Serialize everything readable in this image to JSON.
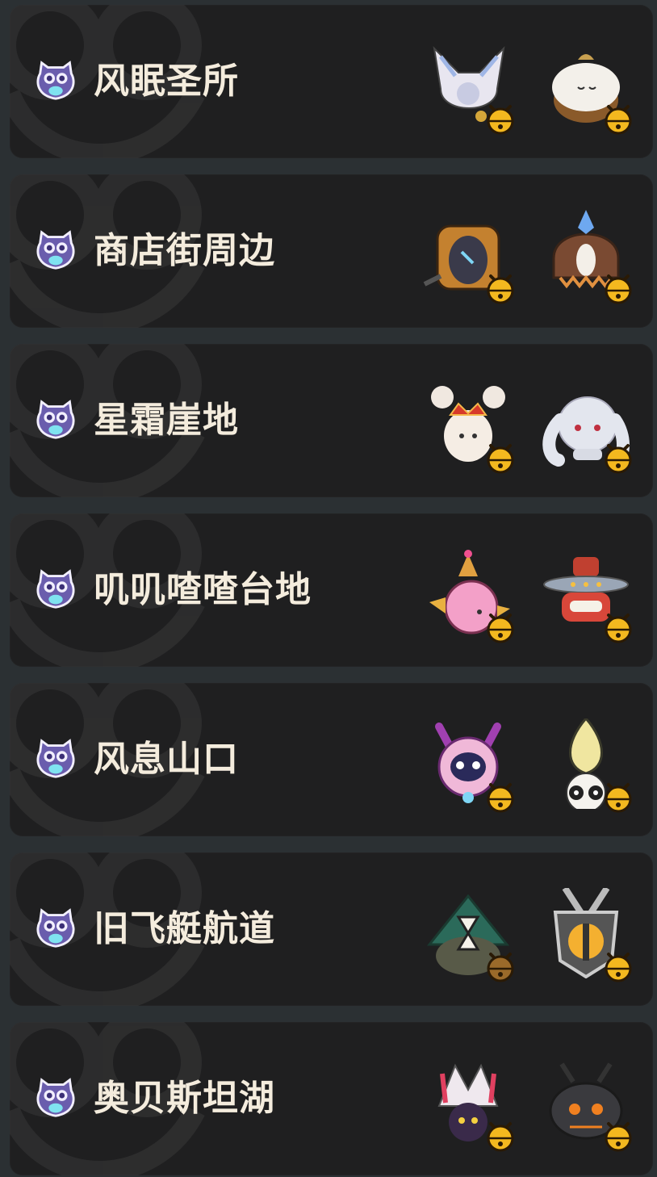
{
  "locations": [
    {
      "name": "风眠圣所",
      "spirits": [
        {
          "icon": "white-fox-spirit-icon",
          "bell": "gold"
        },
        {
          "icon": "white-acorn-spirit-icon",
          "bell": "gold"
        }
      ]
    },
    {
      "name": "商店街周边",
      "spirits": [
        {
          "icon": "bread-mirror-spirit-icon",
          "bell": "gold"
        },
        {
          "icon": "brown-hair-spirit-icon",
          "bell": "gold"
        }
      ]
    },
    {
      "name": "星霜崖地",
      "spirits": [
        {
          "icon": "crowned-bunny-spirit-icon",
          "bell": "gold"
        },
        {
          "icon": "white-floppy-ear-spirit-icon",
          "bell": "gold"
        }
      ]
    },
    {
      "name": "叽叽喳喳台地",
      "spirits": [
        {
          "icon": "pink-party-bird-spirit-icon",
          "bell": "gold"
        },
        {
          "icon": "ufo-robot-spirit-icon",
          "bell": "gold"
        }
      ]
    },
    {
      "name": "风息山口",
      "spirits": [
        {
          "icon": "horned-mask-spirit-icon",
          "bell": "gold"
        },
        {
          "icon": "flame-bulb-spirit-icon",
          "bell": "gold"
        }
      ]
    },
    {
      "name": "旧飞艇航道",
      "spirits": [
        {
          "icon": "hourglass-witch-spirit-icon",
          "bell": "bronze"
        },
        {
          "icon": "shield-knight-spirit-icon",
          "bell": "gold"
        }
      ]
    },
    {
      "name": "奥贝斯坦湖",
      "spirits": [
        {
          "icon": "white-hood-spirit-icon",
          "bell": "gold"
        },
        {
          "icon": "dark-beetle-spirit-icon",
          "bell": "gold"
        }
      ]
    }
  ],
  "colors": {
    "card": "#1f1f20",
    "background": "#2b3033",
    "text": "#f4ecdd",
    "owl": "#6a5dad",
    "bell_gold": "#f3b81f",
    "bell_bronze": "#9a6a2a"
  }
}
